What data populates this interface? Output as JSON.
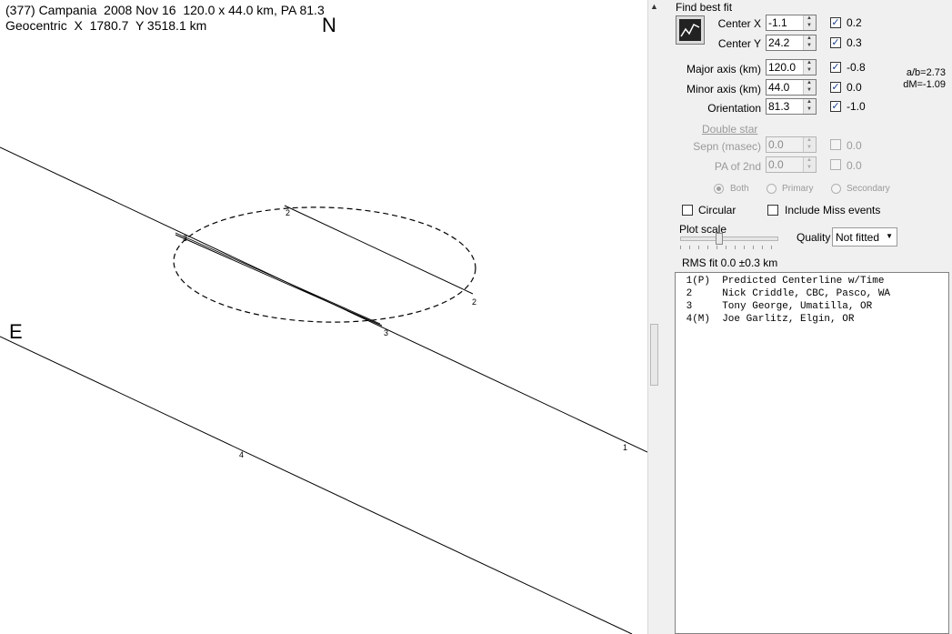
{
  "plot": {
    "title_line1": "(377) Campania  2008 Nov 16  120.0 x 44.0 km, PA 81.3",
    "title_line2": "Geocentric  X  1780.7  Y 3518.1 km",
    "north_label": "N",
    "east_label": "E",
    "chord_labels": [
      "2",
      "2",
      "3",
      "3",
      "1",
      "4"
    ]
  },
  "panel": {
    "find_best_fit": "Find best fit",
    "fields": [
      {
        "label": "Center X",
        "value": "-1.1",
        "checked": true,
        "delta": "0.2"
      },
      {
        "label": "Center Y",
        "value": "24.2",
        "checked": true,
        "delta": "0.3"
      },
      {
        "label": "Major axis (km)",
        "value": "120.0",
        "checked": true,
        "delta": "-0.8"
      },
      {
        "label": "Minor axis (km)",
        "value": "44.0",
        "checked": true,
        "delta": "0.0"
      },
      {
        "label": "Orientation",
        "value": "81.3",
        "checked": true,
        "delta": "-1.0"
      }
    ],
    "ratio": "a/b=2.73",
    "dm": "dM=-1.09",
    "double_star": "Double star",
    "sepn": {
      "label": "Sepn (masec)",
      "value": "0.0",
      "delta": "0.0"
    },
    "pa2": {
      "label": "PA of 2nd",
      "value": "0.0",
      "delta": "0.0"
    },
    "radios": [
      "Both",
      "Primary",
      "Secondary"
    ],
    "circular": "Circular",
    "include_miss": "Include Miss events",
    "plot_scale": "Plot scale",
    "quality_label": "Quality",
    "quality_value": "Not fitted",
    "rms": "RMS fit  0.0 ±0.3 km",
    "chords": [
      " 1(P)  Predicted Centerline w/Time",
      " 2     Nick Criddle, CBC, Pasco, WA",
      " 3     Tony George, Umatilla, OR",
      " 4(M)  Joe Garlitz, Elgin, OR"
    ]
  }
}
